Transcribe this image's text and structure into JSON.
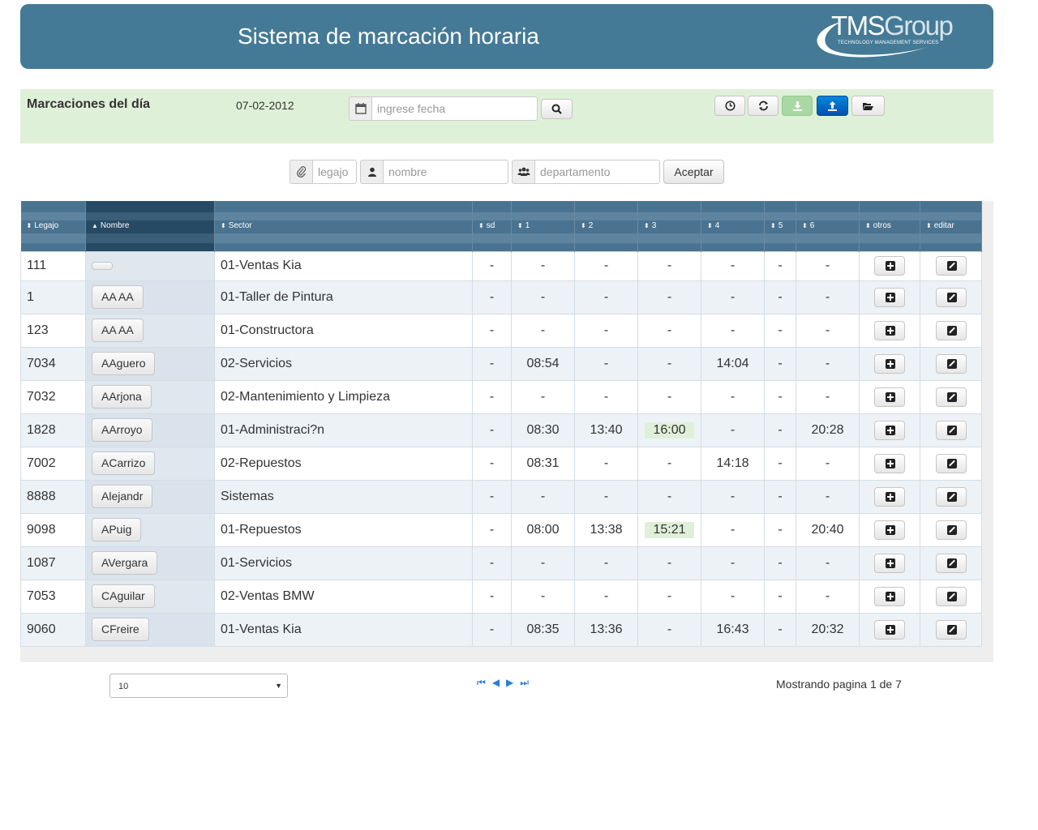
{
  "header": {
    "title": "Sistema de marcación horaria",
    "logo_main": "TMS",
    "logo_group": "Group",
    "logo_sub": "TECHNOLOGY MANAGEMENT SERVICES"
  },
  "toolbar": {
    "label": "Marcaciones del día",
    "date": "07-02-2012",
    "date_placeholder": "ingrese fecha",
    "search_icon": "search-icon",
    "buttons": [
      "clock-icon",
      "refresh-icon",
      "download-icon",
      "upload-icon",
      "folder-open-icon"
    ]
  },
  "filters": {
    "legajo_placeholder": "legajo",
    "nombre_placeholder": "nombre",
    "departamento_placeholder": "departamento",
    "accept_label": "Aceptar"
  },
  "table": {
    "columns": [
      "Legajo",
      "Nombre",
      "Sector",
      "sd",
      "1",
      "2",
      "3",
      "4",
      "5",
      "6",
      "otros",
      "editar"
    ],
    "sorted_column": "Nombre",
    "rows": [
      {
        "legajo": "111",
        "nombre": "",
        "sector": "01-Ventas Kia",
        "sd": "-",
        "t1": "-",
        "t2": "-",
        "t3": "-",
        "t4": "-",
        "t5": "-",
        "t6": "-"
      },
      {
        "legajo": "1",
        "nombre": "AA AA",
        "sector": "01-Taller de Pintura",
        "sd": "-",
        "t1": "-",
        "t2": "-",
        "t3": "-",
        "t4": "-",
        "t5": "-",
        "t6": "-"
      },
      {
        "legajo": "123",
        "nombre": "AA AA",
        "sector": "01-Constructora",
        "sd": "-",
        "t1": "-",
        "t2": "-",
        "t3": "-",
        "t4": "-",
        "t5": "-",
        "t6": "-"
      },
      {
        "legajo": "7034",
        "nombre": "AAguero",
        "sector": "02-Servicios",
        "sd": "-",
        "t1": "08:54",
        "t2": "-",
        "t3": "-",
        "t4": "14:04",
        "t5": "-",
        "t6": "-"
      },
      {
        "legajo": "7032",
        "nombre": "AArjona",
        "sector": "02-Mantenimiento y Limpieza",
        "sd": "-",
        "t1": "-",
        "t2": "-",
        "t3": "-",
        "t4": "-",
        "t5": "-",
        "t6": "-"
      },
      {
        "legajo": "1828",
        "nombre": "AArroyo",
        "sector": "01-Administraci?n",
        "sd": "-",
        "t1": "08:30",
        "t2": "13:40",
        "t3": "16:00",
        "t3_highlight": true,
        "t4": "-",
        "t5": "-",
        "t6": "20:28"
      },
      {
        "legajo": "7002",
        "nombre": "ACarrizo",
        "sector": "02-Repuestos",
        "sd": "-",
        "t1": "08:31",
        "t2": "-",
        "t3": "-",
        "t4": "14:18",
        "t5": "-",
        "t6": "-"
      },
      {
        "legajo": "8888",
        "nombre": "Alejandr",
        "sector": "Sistemas",
        "sd": "-",
        "t1": "-",
        "t2": "-",
        "t3": "-",
        "t4": "-",
        "t5": "-",
        "t6": "-"
      },
      {
        "legajo": "9098",
        "nombre": "APuig",
        "sector": "01-Repuestos",
        "sd": "-",
        "t1": "08:00",
        "t2": "13:38",
        "t3": "15:21",
        "t3_highlight": true,
        "t4": "-",
        "t5": "-",
        "t6": "20:40"
      },
      {
        "legajo": "1087",
        "nombre": "AVergara",
        "sector": "01-Servicios",
        "sd": "-",
        "t1": "-",
        "t2": "-",
        "t3": "-",
        "t4": "-",
        "t5": "-",
        "t6": "-"
      },
      {
        "legajo": "7053",
        "nombre": "CAguilar",
        "sector": "02-Ventas BMW",
        "sd": "-",
        "t1": "-",
        "t2": "-",
        "t3": "-",
        "t4": "-",
        "t5": "-",
        "t6": "-"
      },
      {
        "legajo": "9060",
        "nombre": "CFreire",
        "sector": "01-Ventas Kia",
        "sd": "-",
        "t1": "08:35",
        "t2": "13:36",
        "t3": "-",
        "t4": "16:43",
        "t5": "-",
        "t6": "20:32"
      }
    ]
  },
  "pager": {
    "page_size": "10",
    "info": "Mostrando pagina 1 de 7"
  },
  "colors": {
    "header_bg": "#447a96",
    "toolbar_bg": "#dff0d8",
    "highlight": "#dff0d8",
    "primary": "#0066cc"
  }
}
